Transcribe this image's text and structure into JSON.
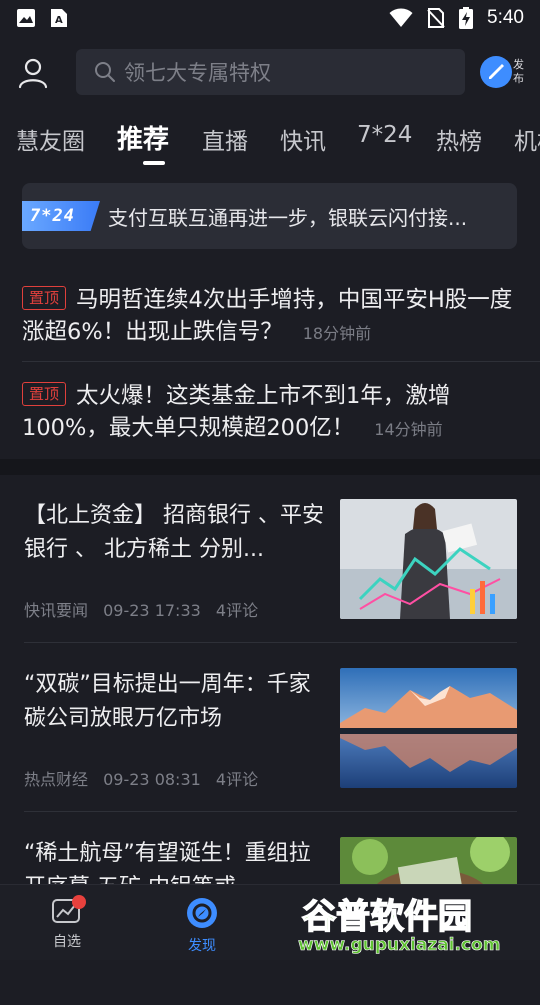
{
  "status_bar": {
    "time": "5:40"
  },
  "search": {
    "placeholder": "领七大专属特权"
  },
  "publish": {
    "label": "发布"
  },
  "tabs": [
    "慧友圈",
    "推荐",
    "直播",
    "快讯",
    "7*24",
    "热榜",
    "机构"
  ],
  "active_tab": "推荐",
  "flash": {
    "badge": "7*24",
    "text": "支付互联互通再进一步，银联云闪付接..."
  },
  "pinned": [
    {
      "badge": "置顶",
      "title": "马明哲连续4次出手增持，中国平安H股一度涨超6%！出现止跌信号？",
      "time": "18分钟前"
    },
    {
      "badge": "置顶",
      "title": "太火爆！这类基金上市不到1年，激增100%，最大单只规模超200亿！",
      "time": "14分钟前"
    }
  ],
  "news": [
    {
      "title": "【北上资金】 招商银行 、平安银行 、 北方稀土 分别...",
      "source": "快讯要闻",
      "time": "09-23 17:33",
      "comments": "4评论"
    },
    {
      "title": "“双碳”目标提出一周年：千家碳公司放眼万亿市场",
      "source": "热点财经",
      "time": "09-23 08:31",
      "comments": "4评论"
    },
    {
      "title": "“稀土航母”有望诞生！重组拉开序幕 五矿 中铝等或",
      "source": "",
      "time": "",
      "comments": ""
    }
  ],
  "bottom_nav": [
    {
      "label": "自选",
      "icon": "chart-icon",
      "badge_dot": true
    },
    {
      "label": "发现",
      "icon": "discover-icon",
      "active": true
    }
  ],
  "watermark": {
    "brand": "谷普软件园",
    "url": "www.gupuxiazai.com"
  },
  "colors": {
    "accent": "#3e8dff",
    "pin_red": "#e0403c",
    "background": "#1c1d24"
  }
}
